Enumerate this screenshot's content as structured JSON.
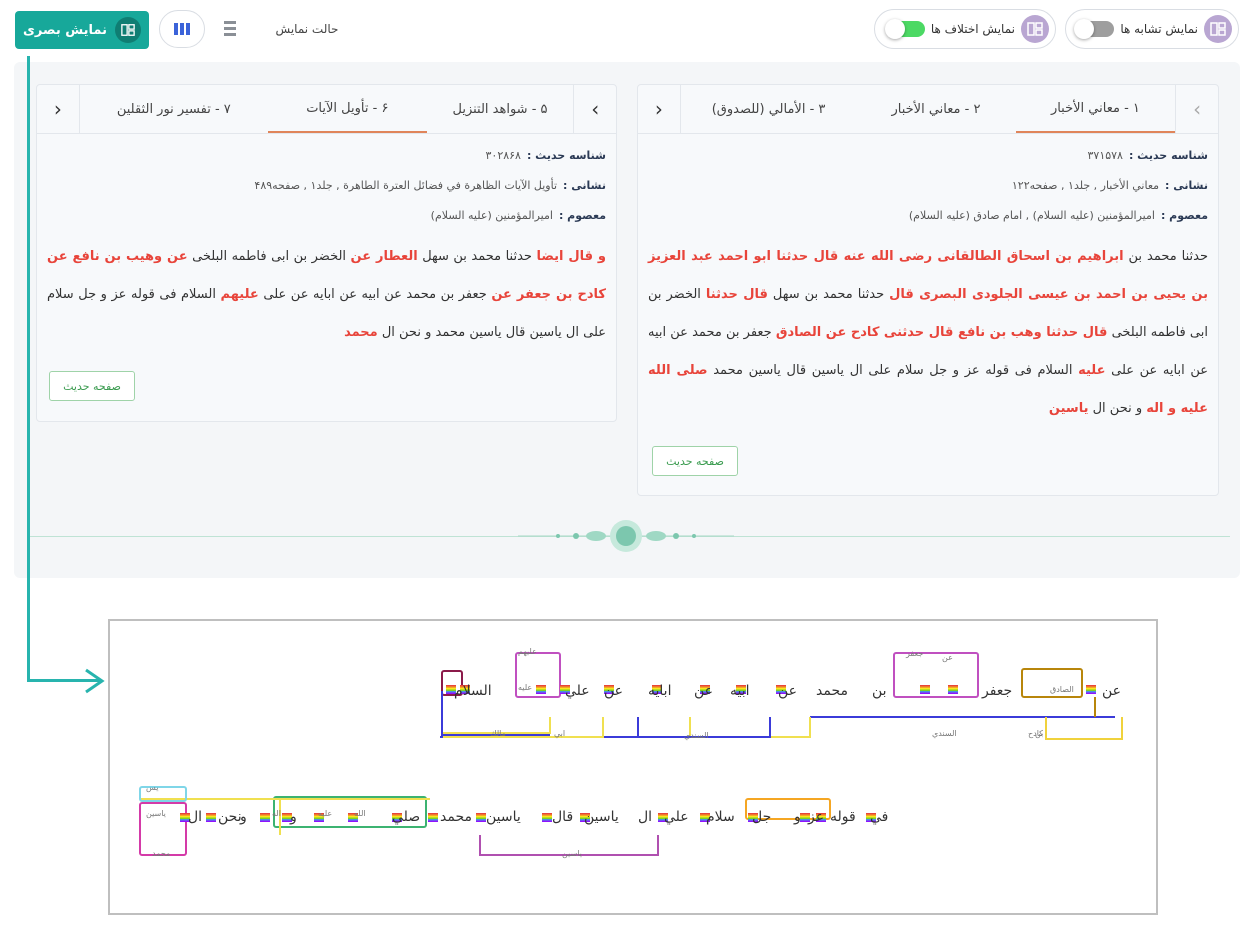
{
  "toolbar": {
    "similarity_label": "نمایش تشابه ها",
    "difference_label": "نمایش اختلاف ها",
    "mode_label": "حالت نمایش",
    "visual_button_label": "نمایش بصری",
    "colors": {
      "accent": "#17a89a",
      "toggle_on": "#4cd964",
      "toggle_off": "#9e9e9e",
      "highlight": "#e8443a"
    }
  },
  "left_panel": {
    "tabs": [
      "۱ - معاني الأخبار",
      "۲ - معاني الأخبار",
      "۳ - الأمالي (للصدوق)"
    ],
    "active_tab": 0,
    "hadith_id_label": "شناسه حدیث :",
    "hadith_id": "۳۷۱۵۷۸",
    "address_label": "نشانی :",
    "address": "معاني الأخبار , جلد۱ , صفحه۱۲۲",
    "masoom_label": "معصوم :",
    "masoom": "اميرالمؤمنين (عليه السلام) , امام صادق (عليه السلام)",
    "text_segments": [
      {
        "t": "حدثنا محمد بن ",
        "h": false
      },
      {
        "t": "ابراهيم بن اسحاق الطالقانی رضی الله عنه قال حدثنا ابو احمد عبد العزيز بن يحيی بن احمد بن عيسی الجلودی البصری قال",
        "h": true
      },
      {
        "t": " حدثنا محمد بن سهل ",
        "h": false
      },
      {
        "t": "قال حدثنا",
        "h": true
      },
      {
        "t": " الخضر بن ابی فاطمه البلخی ",
        "h": false
      },
      {
        "t": "قال حدثنا وهب بن نافع قال حدثنی كادح عن الصادق",
        "h": true
      },
      {
        "t": " جعفر بن محمد عن ابيه عن ابايه عن علی ",
        "h": false
      },
      {
        "t": "عليه",
        "h": true
      },
      {
        "t": " السلام فی قوله عز و جل سلام علی ال ياسين قال ياسين محمد ",
        "h": false
      },
      {
        "t": "صلی الله عليه و اله",
        "h": true
      },
      {
        "t": " و نحن ال ",
        "h": false
      },
      {
        "t": "ياسين",
        "h": true
      }
    ],
    "page_button": "صفحه حدیث"
  },
  "right_panel": {
    "tabs": [
      "۵ - شواهد التنزيل",
      "۶ - تأويل الآيات",
      "۷ - تفسير نور الثقلين"
    ],
    "active_tab": 1,
    "hadith_id_label": "شناسه حدیث :",
    "hadith_id": "۳۰۲۸۶۸",
    "address_label": "نشانی :",
    "address": "تأويل الآيات الظاهرة في فضائل العترة الطاهرة , جلد۱ , صفحه۴۸۹",
    "masoom_label": "معصوم :",
    "masoom": "اميرالمؤمنين (عليه السلام)",
    "text_segments": [
      {
        "t": "و قال ايضا",
        "h": true
      },
      {
        "t": " حدثنا محمد بن سهل ",
        "h": false
      },
      {
        "t": "العطار عن",
        "h": true
      },
      {
        "t": " الخضر بن ابی فاطمه البلخی ",
        "h": false
      },
      {
        "t": "عن وهيب بن نافع عن كادح بن جعفر عن",
        "h": true
      },
      {
        "t": " جعفر بن محمد عن ابيه عن ابايه عن علی ",
        "h": false
      },
      {
        "t": "عليهم",
        "h": true
      },
      {
        "t": " السلام فی قوله عز و جل سلام علی ال ياسين قال ياسين محمد و نحن ال ",
        "h": false
      },
      {
        "t": "محمد",
        "h": true
      }
    ],
    "page_button": "صفحه حدیث"
  },
  "diagram": {
    "row1": [
      "عن",
      "الصادق",
      "جعفر",
      "بن",
      "محمد",
      "عن",
      "ابيه",
      "عن",
      "ابايه",
      "عن",
      "علي",
      "عليه",
      "السلام"
    ],
    "row1_small": [
      "كادح",
      "بن",
      "السندي",
      "عن",
      "جعفر",
      "السندي",
      "علیهم",
      "مالك",
      "ابي"
    ],
    "row2": [
      "في",
      "قوله",
      "عز",
      "و",
      "جل",
      "سلام",
      "علي",
      "ال",
      "ياسين",
      "قال",
      "ياسين",
      "محمد",
      "صلي",
      "الله",
      "عليه",
      "و",
      "اله",
      "و",
      "نحن",
      "ال",
      "ياسين"
    ],
    "row2_small": [
      "ياسين",
      "محمد",
      "يس"
    ]
  }
}
